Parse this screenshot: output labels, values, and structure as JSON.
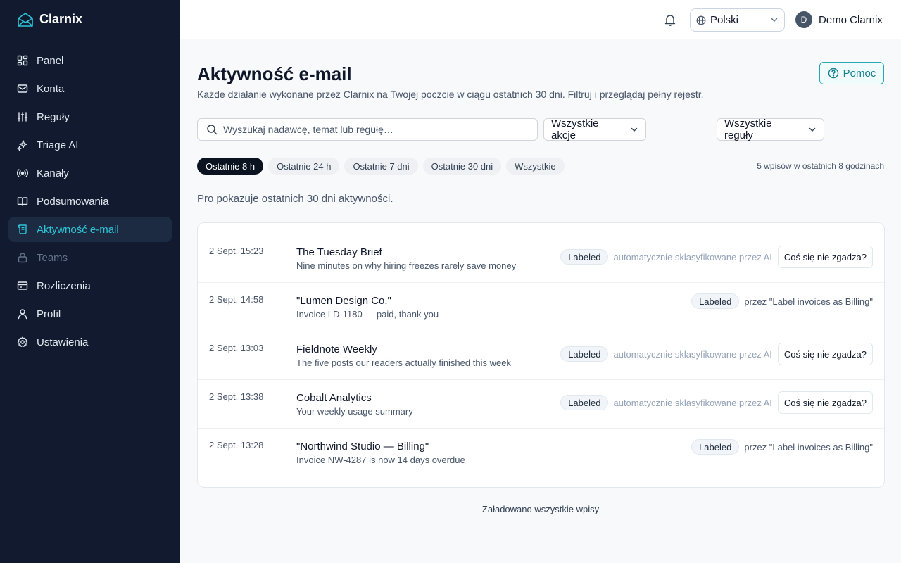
{
  "brand": {
    "name": "Clarnix"
  },
  "sidebar": {
    "items": [
      {
        "label": "Panel",
        "icon": "grid-icon",
        "active": false,
        "disabled": false
      },
      {
        "label": "Konta",
        "icon": "mail-icon",
        "active": false,
        "disabled": false
      },
      {
        "label": "Reguły",
        "icon": "sliders-icon",
        "active": false,
        "disabled": false
      },
      {
        "label": "Triage AI",
        "icon": "sparkles-icon",
        "active": false,
        "disabled": false
      },
      {
        "label": "Kanały",
        "icon": "radio-icon",
        "active": false,
        "disabled": false
      },
      {
        "label": "Podsumowania",
        "icon": "book-icon",
        "active": false,
        "disabled": false
      },
      {
        "label": "Aktywność e-mail",
        "icon": "scroll-icon",
        "active": true,
        "disabled": false
      },
      {
        "label": "Teams",
        "icon": "lock-icon",
        "active": false,
        "disabled": true
      },
      {
        "label": "Rozliczenia",
        "icon": "wallet-icon",
        "active": false,
        "disabled": false
      },
      {
        "label": "Profil",
        "icon": "user-icon",
        "active": false,
        "disabled": false
      },
      {
        "label": "Ustawienia",
        "icon": "gear-icon",
        "active": false,
        "disabled": false
      }
    ]
  },
  "topbar": {
    "language": "Polski",
    "user_initial": "D",
    "user_name": "Demo Clarnix"
  },
  "page": {
    "title": "Aktywność e-mail",
    "subtitle": "Każde działanie wykonane przez Clarnix na Twojej poczcie w ciągu ostatnich 30 dni. Filtruj i przeglądaj pełny rejestr.",
    "help_label": "Pomoc"
  },
  "filters": {
    "search_placeholder": "Wyszukaj nadawcę, temat lub regułę…",
    "actions_label": "Wszystkie akcje",
    "rules_label": "Wszystkie reguły",
    "ranges": [
      {
        "label": "Ostatnie 8 h",
        "active": true
      },
      {
        "label": "Ostatnie 24 h",
        "active": false
      },
      {
        "label": "Ostatnie 7 dni",
        "active": false
      },
      {
        "label": "Ostatnie 30 dni",
        "active": false
      },
      {
        "label": "Wszystkie",
        "active": false
      }
    ],
    "count_text": "5 wpisów w ostatnich 8 godzinach"
  },
  "pro_note": "Pro pokazuje ostatnich 30 dni aktywności.",
  "entries": [
    {
      "time": "2 Sept, 15:23",
      "sender": "The Tuesday Brief",
      "subject": "Nine minutes on why hiring freezes rarely save money",
      "badge": "Labeled",
      "note": "automatycznie sklasyfikowane przez AI",
      "dispute": "Coś się nie zgadza?"
    },
    {
      "time": "2 Sept, 14:58",
      "sender": "\"Lumen Design Co.\"",
      "subject": "Invoice LD-1180 — paid, thank you",
      "badge": "Labeled",
      "note": "przez \"Label invoices as Billing\"",
      "dispute": ""
    },
    {
      "time": "2 Sept, 13:03",
      "sender": "Fieldnote Weekly",
      "subject": "The five posts our readers actually finished this week",
      "badge": "Labeled",
      "note": "automatycznie sklasyfikowane przez AI",
      "dispute": "Coś się nie zgadza?"
    },
    {
      "time": "2 Sept, 13:38",
      "sender": "Cobalt Analytics",
      "subject": "Your weekly usage summary",
      "badge": "Labeled",
      "note": "automatycznie sklasyfikowane przez AI",
      "dispute": "Coś się nie zgadza?"
    },
    {
      "time": "2 Sept, 13:28",
      "sender": "\"Northwind Studio — Billing\"",
      "subject": "Invoice NW-4287 is now 14 days overdue",
      "badge": "Labeled",
      "note": "przez \"Label invoices as Billing\"",
      "dispute": ""
    }
  ],
  "footer_note": "Załadowano wszystkie wpisy",
  "colors": {
    "sidebar_bg": "#111a2e",
    "accent": "#2ec4d6",
    "active_item_bg": "#1c2b42"
  }
}
